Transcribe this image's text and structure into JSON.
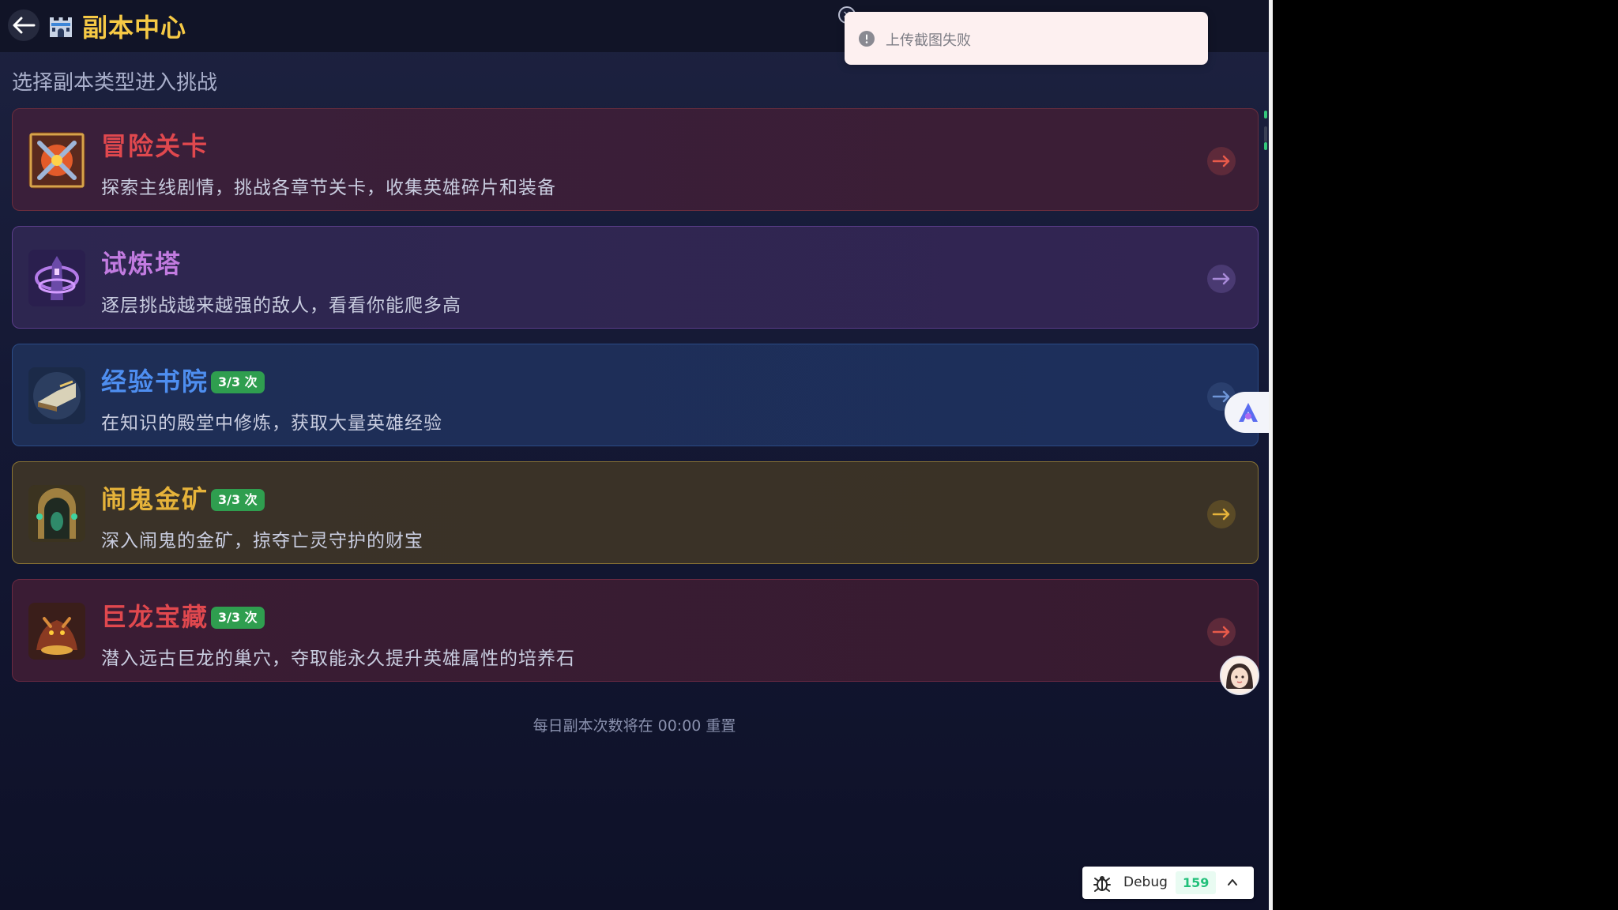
{
  "header": {
    "title": "副本中心",
    "back_icon": "arrow-left-icon",
    "title_icon": "castle-icon"
  },
  "subtitle": "选择副本类型进入挑战",
  "dungeons": [
    {
      "name": "冒险关卡",
      "desc": "探索主线剧情，挑战各章节关卡，收集英雄碎片和装备",
      "badge": "",
      "color": "#e0484e",
      "icon": "crossed-swords-icon"
    },
    {
      "name": "试炼塔",
      "desc": "逐层挑战越来越强的敌人，看看你能爬多高",
      "badge": "",
      "color": "#c27be0",
      "icon": "tower-icon"
    },
    {
      "name": "经验书院",
      "desc": "在知识的殿堂中修炼，获取大量英雄经验",
      "badge": "3/3 次",
      "color": "#4e8ef0",
      "icon": "book-icon"
    },
    {
      "name": "闹鬼金矿",
      "desc": "深入闹鬼的金矿，掠夺亡灵守护的财宝",
      "badge": "3/3 次",
      "color": "#e6b33a",
      "icon": "mine-gate-icon"
    },
    {
      "name": "巨龙宝藏",
      "desc": "潜入远古巨龙的巢穴，夺取能永久提升英雄属性的培养石",
      "badge": "3/3 次",
      "color": "#e0484e",
      "icon": "dragon-icon"
    }
  ],
  "footer_note": "每日副本次数将在 00:00 重置",
  "toast": {
    "text": "上传截图失败",
    "icon": "exclamation-circle-icon"
  },
  "debug": {
    "label": "Debug",
    "count": "159",
    "icon": "bug-icon"
  },
  "colors": {
    "title": "#f6c945",
    "badge": "#2f9e4f"
  }
}
